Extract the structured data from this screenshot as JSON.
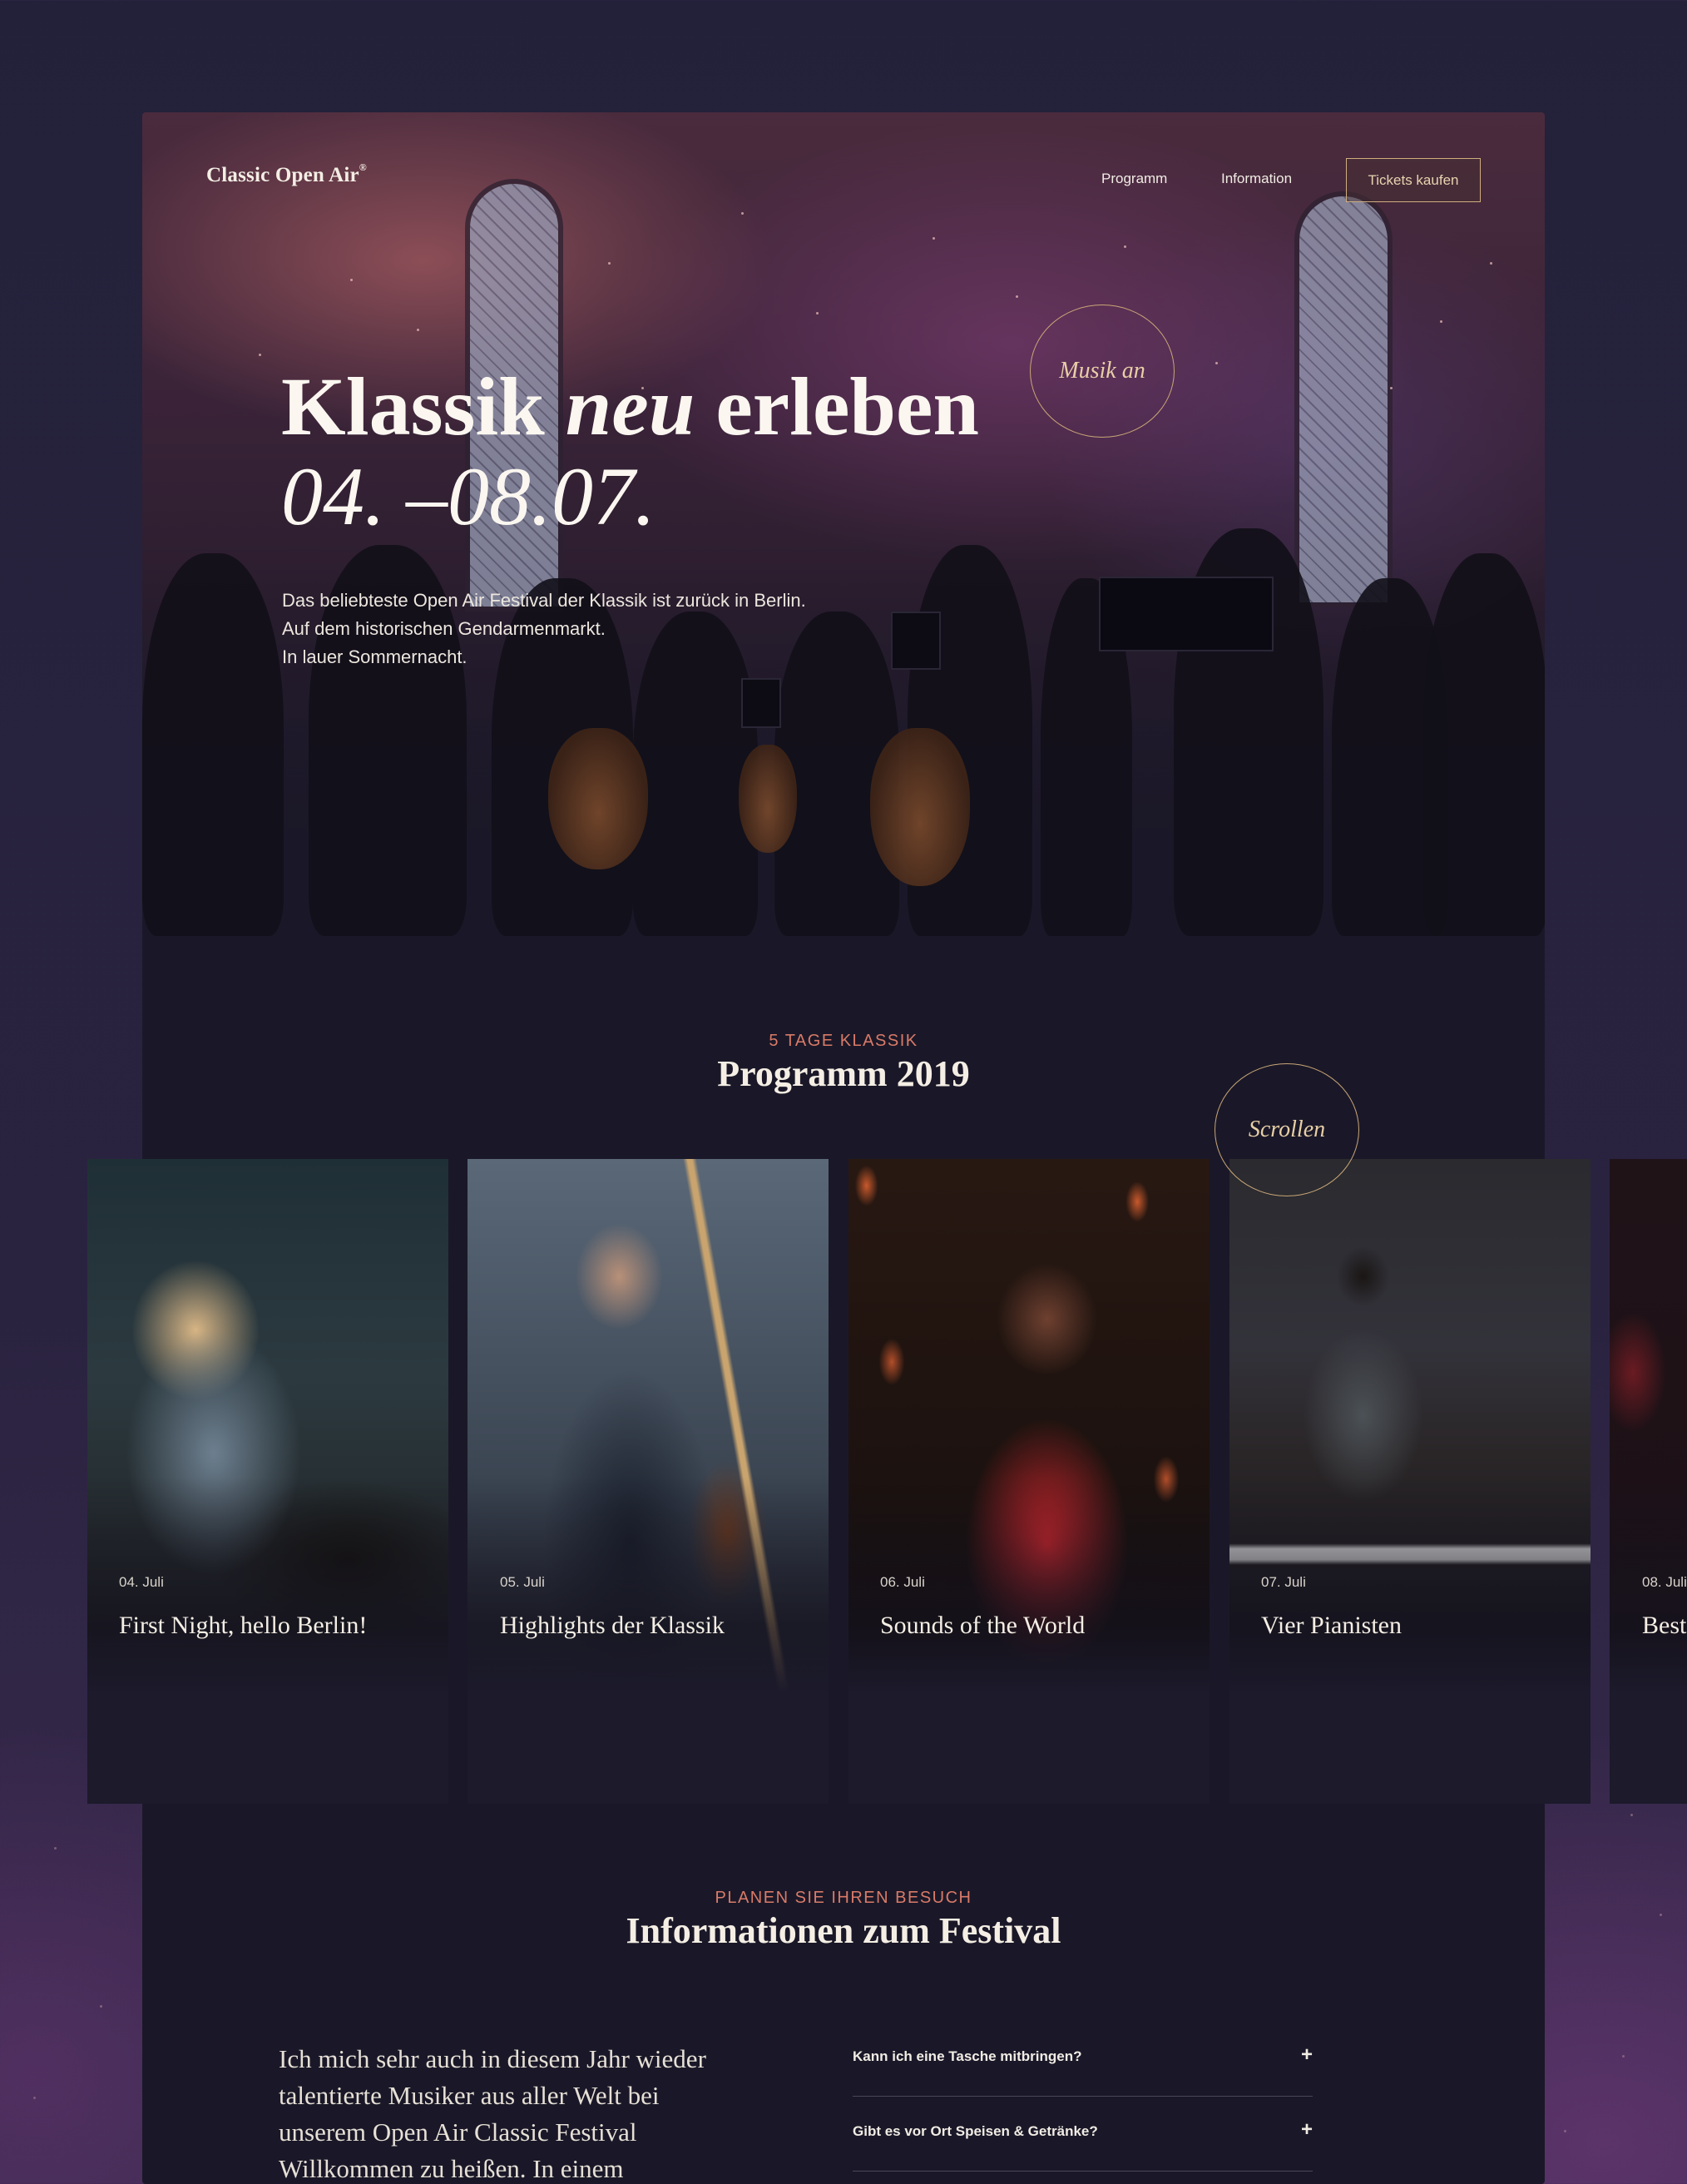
{
  "header": {
    "logo": "Classic Open Air",
    "logo_mark": "®",
    "nav": [
      "Programm",
      "Information"
    ],
    "cta": "Tickets kaufen"
  },
  "hero": {
    "title_start": "Klassik ",
    "title_emph": "neu",
    "title_end": " erleben",
    "dates": "04. –08.07.",
    "music_button": "Musik an",
    "lines": [
      "Das beliebteste Open Air Festival der Klassik ist zurück in Berlin.",
      "Auf dem historischen Gendarmenmarkt.",
      "In lauer Sommernacht."
    ]
  },
  "program": {
    "eyebrow": "5 TAGE KLASSIK",
    "title": "Programm 2019",
    "scroll_button": "Scrollen",
    "cards": [
      {
        "date": "04. Juli",
        "title": "First Night, hello Berlin!"
      },
      {
        "date": "05. Juli",
        "title": "Highlights der Klassik"
      },
      {
        "date": "06. Juli",
        "title": "Sounds of the World"
      },
      {
        "date": "07. Juli",
        "title": "Vier Pianisten"
      },
      {
        "date": "08. Juli",
        "title": "Best"
      }
    ]
  },
  "info": {
    "eyebrow": "PLANEN SIE IHREN BESUCH",
    "title": "Informationen zum Festival",
    "body": "Ich mich sehr auch in diesem Jahr wieder talentierte Musiker aus aller Welt bei unserem Open Air Classic Festival Willkommen zu heißen. In einem",
    "faq": [
      {
        "question": "Kann ich eine Tasche mitbringen?",
        "icon": "+"
      },
      {
        "question": "Gibt es vor Ort Speisen & Getränke?",
        "icon": "+"
      }
    ]
  }
}
